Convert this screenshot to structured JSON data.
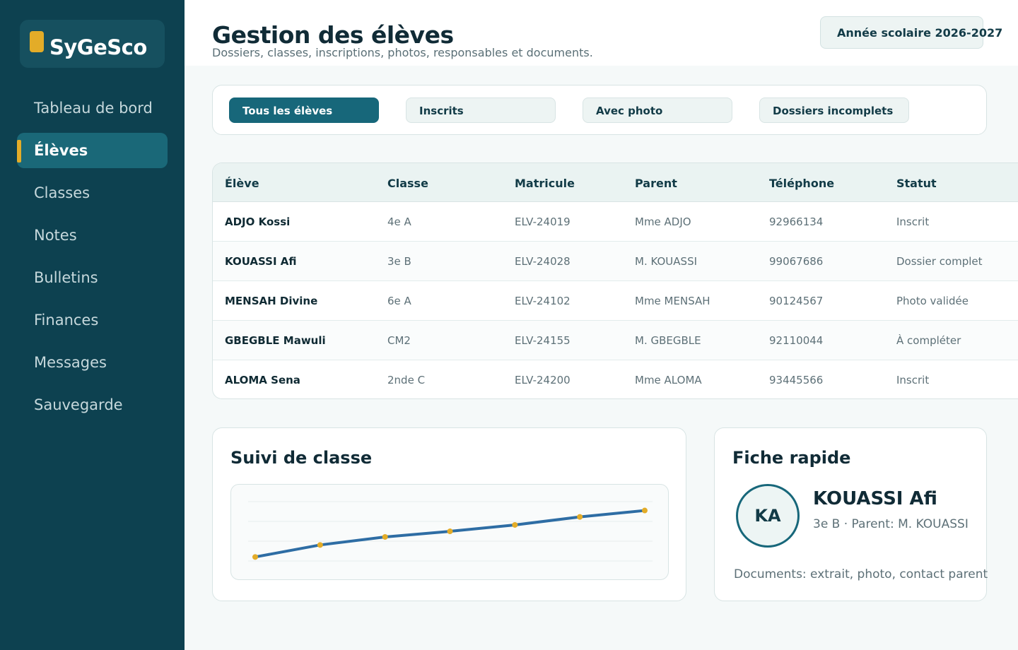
{
  "app": {
    "name": "SyGeSco"
  },
  "sidebar": {
    "items": [
      {
        "label": "Tableau de bord",
        "active": false
      },
      {
        "label": "Élèves",
        "active": true
      },
      {
        "label": "Classes",
        "active": false
      },
      {
        "label": "Notes",
        "active": false
      },
      {
        "label": "Bulletins",
        "active": false
      },
      {
        "label": "Finances",
        "active": false
      },
      {
        "label": "Messages",
        "active": false
      },
      {
        "label": "Sauvegarde",
        "active": false
      }
    ]
  },
  "header": {
    "title": "Gestion des élèves",
    "subtitle": "Dossiers, classes, inscriptions, photos, responsables et documents.",
    "year_badge": "Année scolaire 2026-2027"
  },
  "filters": [
    {
      "label": "Tous les élèves",
      "active": true
    },
    {
      "label": "Inscrits",
      "active": false
    },
    {
      "label": "Avec photo",
      "active": false
    },
    {
      "label": "Dossiers incomplets",
      "active": false
    }
  ],
  "table": {
    "columns": [
      "Élève",
      "Classe",
      "Matricule",
      "Parent",
      "Téléphone",
      "Statut"
    ],
    "rows": [
      [
        "ADJO Kossi",
        "4e A",
        "ELV-24019",
        "Mme ADJO",
        "92966134",
        "Inscrit"
      ],
      [
        "KOUASSI Afi",
        "3e B",
        "ELV-24028",
        "M. KOUASSI",
        "99067686",
        "Dossier complet"
      ],
      [
        "MENSAH Divine",
        "6e A",
        "ELV-24102",
        "Mme MENSAH",
        "90124567",
        "Photo validée"
      ],
      [
        "GBEGBLE Mawuli",
        "CM2",
        "ELV-24155",
        "M. GBEGBLE",
        "92110044",
        "À compléter"
      ],
      [
        "ALOMA Sena",
        "2nde C",
        "ELV-24200",
        "Mme ALOMA",
        "93445566",
        "Inscrit"
      ]
    ]
  },
  "class_tracking": {
    "title": "Suivi de classe"
  },
  "chart_data": {
    "type": "line",
    "title": "",
    "xlabel": "",
    "ylabel": "",
    "x": [
      1,
      2,
      3,
      4,
      5,
      6,
      7
    ],
    "series": [
      {
        "values": [
          5,
          20,
          30,
          37,
          45,
          55,
          63
        ]
      }
    ],
    "ylim": [
      0,
      100
    ],
    "grid": true,
    "colors": {
      "line": "#2e6da4",
      "points": "#e3ac28"
    }
  },
  "quick_sheet": {
    "title": "Fiche rapide",
    "initials": "KA",
    "name": "KOUASSI Afi",
    "meta": "3e B · Parent: M. KOUASSI",
    "documents": "Documents: extrait, photo, contact parent"
  },
  "colors": {
    "sidebar_bg": "#0d4150",
    "active_item": "#1a6878",
    "accent": "#e3ac28",
    "primary": "#17677a"
  }
}
